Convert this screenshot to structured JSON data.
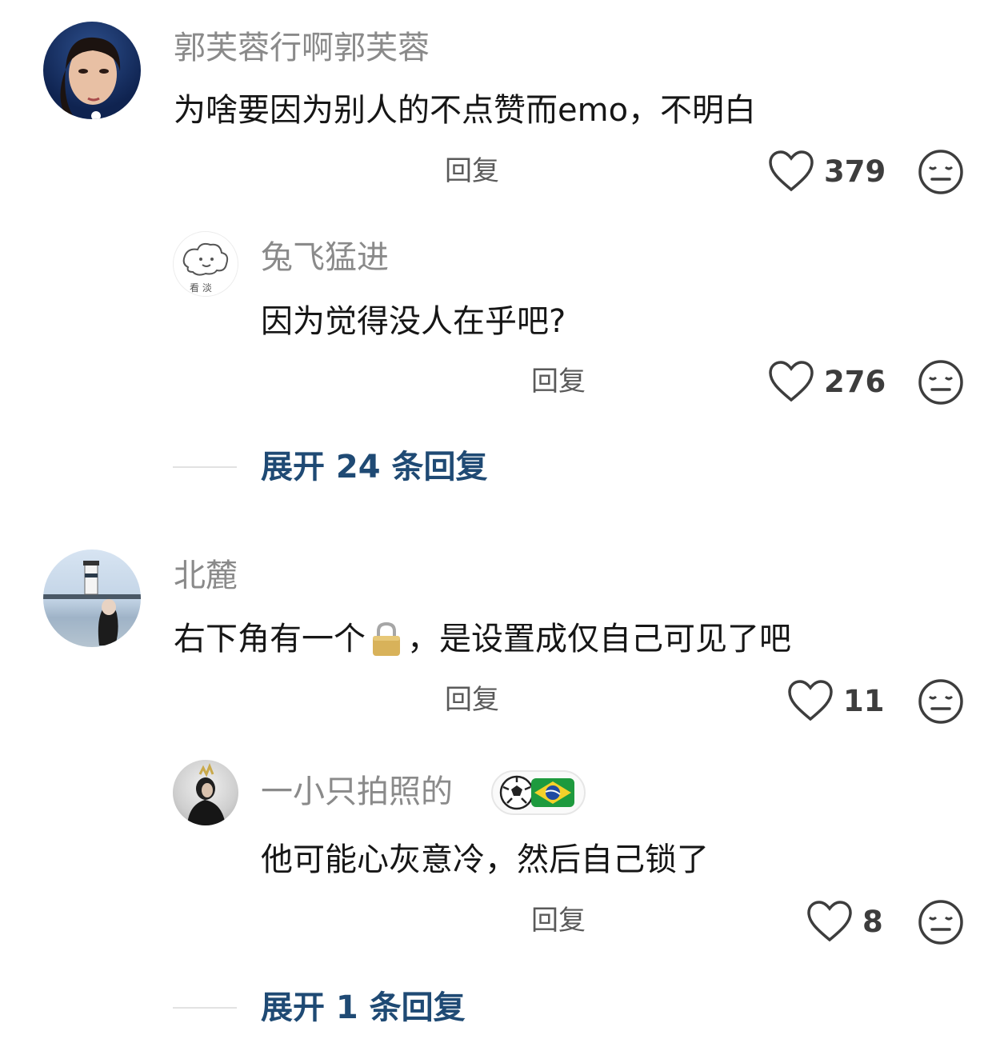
{
  "comments": [
    {
      "author": "郭芙蓉行啊郭芙蓉",
      "text": "为啥要因为别人的不点赞而emo，不明白",
      "reply_label": "回复",
      "likes": "379",
      "reply": {
        "author": "兔飞猛进",
        "avatar_caption": "看 淡",
        "text": "因为觉得没人在乎吧?",
        "reply_label": "回复",
        "likes": "276"
      },
      "expand_label": "展开 24 条回复"
    },
    {
      "author": "北麓",
      "text_before": "右下角有一个",
      "text_after": "，是设置成仅自己可见了吧",
      "reply_label": "回复",
      "likes": "11",
      "reply": {
        "author": "一小只拍照的",
        "text": "他可能心灰意冷，然后自己锁了",
        "reply_label": "回复",
        "likes": "8"
      },
      "expand_label": "展开 1 条回复"
    }
  ],
  "icons": {
    "like": "heart-outline-icon",
    "dislike": "meh-face-icon",
    "lock": "lock-icon",
    "badge": [
      "soccer-ball-icon",
      "brazil-flag-icon"
    ]
  },
  "colors": {
    "name": "#8a8a8a",
    "text": "#161616",
    "expand": "#1f4a74"
  }
}
